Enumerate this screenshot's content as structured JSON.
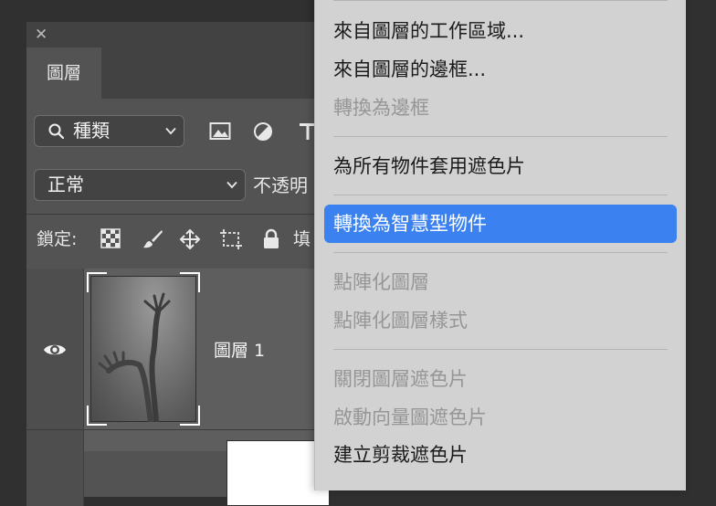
{
  "layers_panel": {
    "close_glyph": "✕",
    "tab_label": "圖層",
    "filter": {
      "selected": "種類",
      "icons": [
        "search-icon",
        "image-filter-icon",
        "adjustment-filter-icon",
        "type-filter-icon"
      ]
    },
    "blend_mode": {
      "selected": "正常"
    },
    "opacity_label": "不透明",
    "lock_label": "鎖定:",
    "lock_icons": [
      "lock-transparent-pixels-icon",
      "lock-image-pixels-icon",
      "lock-position-icon",
      "lock-artboard-icon",
      "lock-all-icon"
    ],
    "fill_label": "填",
    "layers": [
      {
        "name": "圖層 1",
        "visible": true
      }
    ]
  },
  "context_menu": {
    "items": [
      {
        "label": "來自圖層的工作區域...",
        "enabled": true
      },
      {
        "label": "來自圖層的邊框...",
        "enabled": true
      },
      {
        "label": "轉換為邊框",
        "enabled": false
      },
      {
        "label": "為所有物件套用遮色片",
        "enabled": true
      },
      {
        "label": "轉換為智慧型物件",
        "enabled": true,
        "highlighted": true
      },
      {
        "label": "點陣化圖層",
        "enabled": false
      },
      {
        "label": "點陣化圖層樣式",
        "enabled": false
      },
      {
        "label": "關閉圖層遮色片",
        "enabled": false
      },
      {
        "label": "啟動向量圖遮色片",
        "enabled": false
      },
      {
        "label": "建立剪裁遮色片",
        "enabled": true
      }
    ],
    "highlight_color": "#3b82f0"
  }
}
